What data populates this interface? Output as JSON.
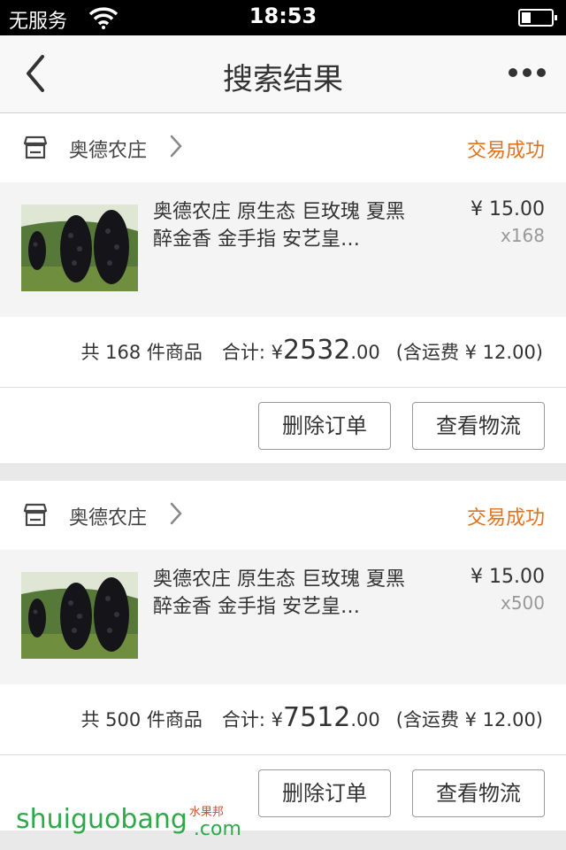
{
  "status_bar": {
    "carrier": "无服务",
    "time": "18:53",
    "battery_level": 0.3
  },
  "nav": {
    "title": "搜索结果",
    "back_icon": "chevron-left-icon",
    "more_icon": "more-dots-icon"
  },
  "orders": [
    {
      "shop_name": "奥德农庄",
      "status": "交易成功",
      "item_title": "奥德农庄 原生态 巨玫瑰 夏黑 醉金香 金手指 安艺皇…",
      "price": "¥ 15.00",
      "qty": "x168",
      "count_text": "共 168 件商品",
      "total_label": "合计: ¥",
      "total_int": "2532",
      "total_dec": ".00",
      "shipping": "(含运费 ¥ 12.00)",
      "delete_label": "删除订单",
      "logistics_label": "查看物流"
    },
    {
      "shop_name": "奥德农庄",
      "status": "交易成功",
      "item_title": "奥德农庄 原生态 巨玫瑰 夏黑 醉金香 金手指 安艺皇…",
      "price": "¥ 15.00",
      "qty": "x500",
      "count_text": "共 500 件商品",
      "total_label": "合计: ¥",
      "total_int": "7512",
      "total_dec": ".00",
      "shipping": "(含运费 ¥ 12.00)",
      "delete_label": "删除订单",
      "logistics_label": "查看物流"
    }
  ],
  "watermark": {
    "main": "shuiguobang",
    "cn": "水果邦",
    "suffix": ".com"
  },
  "colors": {
    "accent_status": "#e2721d",
    "watermark_green": "#2fa84a"
  }
}
